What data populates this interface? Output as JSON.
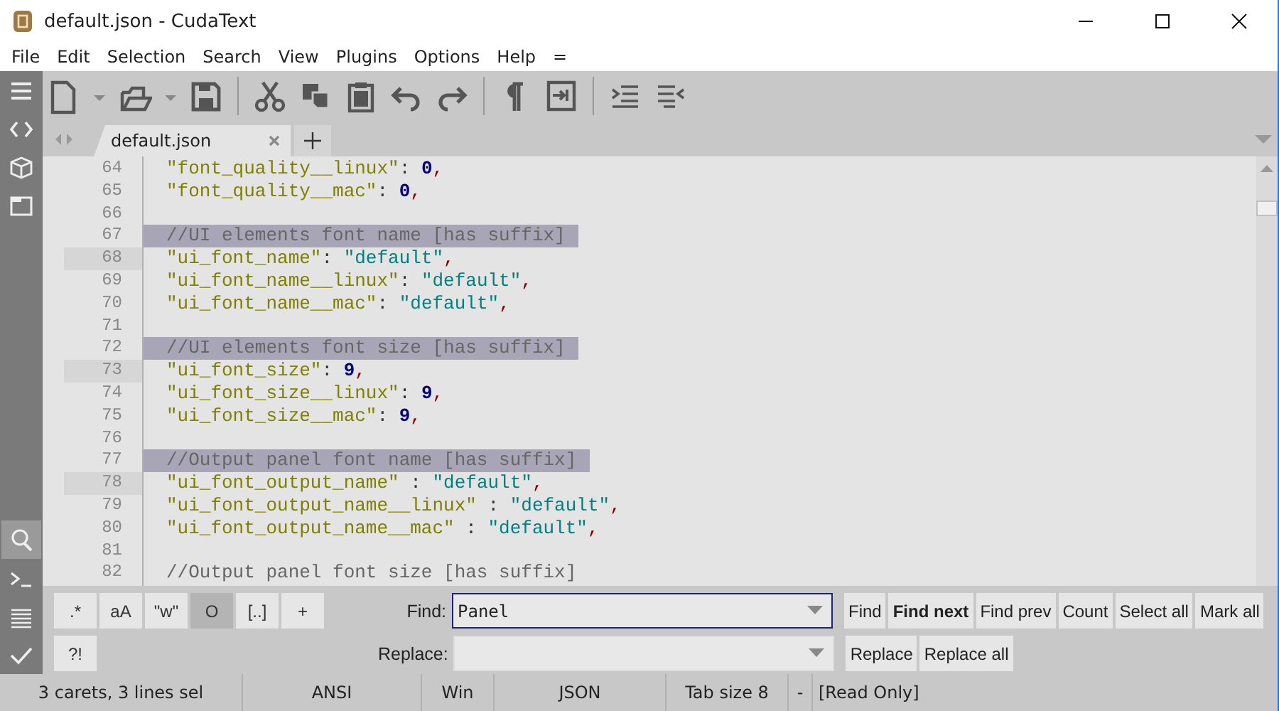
{
  "window": {
    "title": "default.json - CudaText"
  },
  "menu": [
    "File",
    "Edit",
    "Selection",
    "Search",
    "View",
    "Plugins",
    "Options",
    "Help",
    "="
  ],
  "sidebar": {
    "items": [
      {
        "kind": "menu",
        "selected": false
      },
      {
        "kind": "code",
        "selected": false
      },
      {
        "kind": "package",
        "selected": false
      },
      {
        "kind": "tabs",
        "selected": false
      },
      {
        "kind": "search",
        "selected": true
      },
      {
        "kind": "console",
        "selected": false
      },
      {
        "kind": "list",
        "selected": false
      },
      {
        "kind": "check",
        "selected": false
      }
    ]
  },
  "tabs": [
    {
      "label": "default.json",
      "selected": true
    }
  ],
  "editor": {
    "lines": [
      {
        "number": "64",
        "caret": false,
        "selected": false,
        "tokens": [
          {
            "kind": "key",
            "text": "\"font_quality__linux\""
          },
          {
            "kind": "punct",
            "text": ": "
          },
          {
            "kind": "num",
            "text": "0"
          },
          {
            "kind": "comma",
            "text": ","
          }
        ]
      },
      {
        "number": "65",
        "caret": false,
        "selected": false,
        "tokens": [
          {
            "kind": "key",
            "text": "\"font_quality__mac\""
          },
          {
            "kind": "punct",
            "text": ": "
          },
          {
            "kind": "num",
            "text": "0"
          },
          {
            "kind": "comma",
            "text": ","
          }
        ]
      },
      {
        "number": "66",
        "caret": false,
        "selected": false
      },
      {
        "number": "67",
        "caret": false,
        "selected": true,
        "tokens": [
          {
            "kind": "comment",
            "text": "//UI elements font name [has suffix]"
          }
        ]
      },
      {
        "number": "68",
        "caret": true,
        "selected": false,
        "tokens": [
          {
            "kind": "key",
            "text": "\"ui_font_name\""
          },
          {
            "kind": "punct",
            "text": ": "
          },
          {
            "kind": "str",
            "text": "\"default\""
          },
          {
            "kind": "comma",
            "text": ","
          }
        ]
      },
      {
        "number": "69",
        "caret": false,
        "selected": false,
        "tokens": [
          {
            "kind": "key",
            "text": "\"ui_font_name__linux\""
          },
          {
            "kind": "punct",
            "text": ": "
          },
          {
            "kind": "str",
            "text": "\"default\""
          },
          {
            "kind": "comma",
            "text": ","
          }
        ]
      },
      {
        "number": "70",
        "caret": false,
        "selected": false,
        "tokens": [
          {
            "kind": "key",
            "text": "\"ui_font_name__mac\""
          },
          {
            "kind": "punct",
            "text": ": "
          },
          {
            "kind": "str",
            "text": "\"default\""
          },
          {
            "kind": "comma",
            "text": ","
          }
        ]
      },
      {
        "number": "71",
        "caret": false,
        "selected": false
      },
      {
        "number": "72",
        "caret": false,
        "selected": true,
        "tokens": [
          {
            "kind": "comment",
            "text": "//UI elements font size [has suffix]"
          }
        ]
      },
      {
        "number": "73",
        "caret": true,
        "selected": false,
        "tokens": [
          {
            "kind": "key",
            "text": "\"ui_font_size\""
          },
          {
            "kind": "punct",
            "text": ": "
          },
          {
            "kind": "num",
            "text": "9"
          },
          {
            "kind": "comma",
            "text": ","
          }
        ]
      },
      {
        "number": "74",
        "caret": false,
        "selected": false,
        "tokens": [
          {
            "kind": "key",
            "text": "\"ui_font_size__linux\""
          },
          {
            "kind": "punct",
            "text": ": "
          },
          {
            "kind": "num",
            "text": "9"
          },
          {
            "kind": "comma",
            "text": ","
          }
        ]
      },
      {
        "number": "75",
        "caret": false,
        "selected": false,
        "tokens": [
          {
            "kind": "key",
            "text": "\"ui_font_size__mac\""
          },
          {
            "kind": "punct",
            "text": ": "
          },
          {
            "kind": "num",
            "text": "9"
          },
          {
            "kind": "comma",
            "text": ","
          }
        ]
      },
      {
        "number": "76",
        "caret": false,
        "selected": false
      },
      {
        "number": "77",
        "caret": false,
        "selected": true,
        "tokens": [
          {
            "kind": "comment",
            "text": "//Output panel font name [has suffix]"
          }
        ]
      },
      {
        "number": "78",
        "caret": true,
        "selected": false,
        "tokens": [
          {
            "kind": "key",
            "text": "\"ui_font_output_name\""
          },
          {
            "kind": "punct",
            "text": " : "
          },
          {
            "kind": "str",
            "text": "\"default\""
          },
          {
            "kind": "comma",
            "text": ","
          }
        ]
      },
      {
        "number": "79",
        "caret": false,
        "selected": false,
        "tokens": [
          {
            "kind": "key",
            "text": "\"ui_font_output_name__linux\""
          },
          {
            "kind": "punct",
            "text": " : "
          },
          {
            "kind": "str",
            "text": "\"default\""
          },
          {
            "kind": "comma",
            "text": ","
          }
        ]
      },
      {
        "number": "80",
        "caret": false,
        "selected": false,
        "tokens": [
          {
            "kind": "key",
            "text": "\"ui_font_output_name__mac\""
          },
          {
            "kind": "punct",
            "text": " : "
          },
          {
            "kind": "str",
            "text": "\"default\""
          },
          {
            "kind": "comma",
            "text": ","
          }
        ]
      },
      {
        "number": "81",
        "caret": false,
        "selected": false
      },
      {
        "number": "82",
        "caret": false,
        "selected": false,
        "tokens": [
          {
            "kind": "comment",
            "text": "//Output panel font size [has suffix]"
          }
        ]
      }
    ]
  },
  "find_panel": {
    "options": [
      {
        "label": ".*",
        "selected": false
      },
      {
        "label": "aA",
        "selected": false
      },
      {
        "label": "\"w\"",
        "selected": false
      },
      {
        "label": "O",
        "selected": true
      },
      {
        "label": "[..]",
        "selected": false
      },
      {
        "label": "+",
        "selected": false
      }
    ],
    "options_row2": [
      {
        "label": "?!",
        "selected": false
      }
    ],
    "find": {
      "label": "Find:",
      "value": "Panel"
    },
    "replace": {
      "label": "Replace:"
    },
    "find_buttons": [
      {
        "label": "Find",
        "default": false
      },
      {
        "label": "Find next",
        "default": true
      },
      {
        "label": "Find prev",
        "default": false
      },
      {
        "label": "Count",
        "default": false
      },
      {
        "label": "Select all",
        "default": false
      },
      {
        "label": "Mark all",
        "default": false
      }
    ],
    "replace_buttons": [
      {
        "label": "Replace",
        "default": false
      },
      {
        "label": "Replace all",
        "default": false
      }
    ]
  },
  "status_bar": [
    "3 carets, 3 lines sel",
    "ANSI",
    "Win",
    "JSON",
    "Tab size 8",
    "-",
    "[Read Only]"
  ]
}
